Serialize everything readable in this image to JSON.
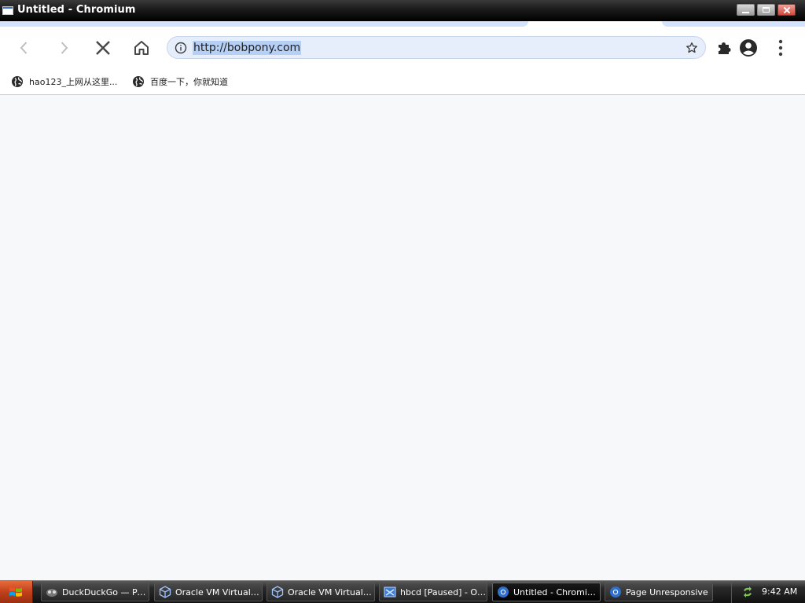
{
  "window": {
    "title": "Untitled - Chromium"
  },
  "toolbar": {
    "url": "http://bobpony.com"
  },
  "bookmarks": [
    {
      "label": "hao123_上网从这里..."
    },
    {
      "label": "百度一下，你就知道"
    }
  ],
  "taskbar": {
    "tasks": [
      {
        "label": "DuckDuckGo — Pri...",
        "icon": "duckduckgo-icon"
      },
      {
        "label": "Oracle VM VirtualB...",
        "icon": "virtualbox-icon"
      },
      {
        "label": "Oracle VM VirtualB...",
        "icon": "virtualbox-icon"
      },
      {
        "label": "hbcd [Paused] - Or...",
        "icon": "vm-window-icon"
      },
      {
        "label": "Untitled - Chromium",
        "icon": "chromium-icon"
      },
      {
        "label": "Page Unresponsive",
        "icon": "chromium-icon"
      }
    ],
    "clock": "9:42 AM"
  },
  "colors": {
    "omnibox_bg": "#e6eefb",
    "url_highlight": "#b6cff5",
    "tab_accent": "#d3e3fd",
    "content_bg": "#f7f8fa"
  }
}
